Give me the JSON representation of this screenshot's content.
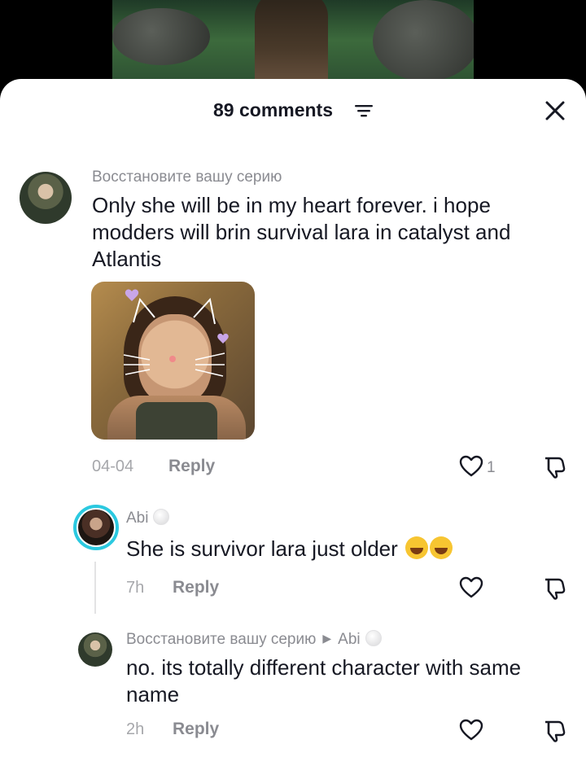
{
  "header": {
    "comment_count": "89 comments"
  },
  "comments": [
    {
      "username": "Восстановите вашу серию",
      "text": "Only she will be in my heart forever. i hope modders will brin survival lara in catalyst and Atlantis",
      "date": "04-04",
      "reply_label": "Reply",
      "likes": "1"
    }
  ],
  "replies": [
    {
      "username": "Abi",
      "text": "She is survivor lara just older",
      "time": "7h",
      "reply_label": "Reply"
    },
    {
      "username": "Восстановите вашу серию",
      "reply_to": "Abi",
      "text": "no. its totally different character with same name",
      "time": "2h",
      "reply_label": "Reply"
    }
  ],
  "colors": {
    "text_primary": "#161823",
    "text_secondary": "#8a8b91",
    "story_ring": "#2bc9e0"
  },
  "icons": [
    "filter-icon",
    "close-icon",
    "heart-icon",
    "dislike-icon",
    "laughing-emoji"
  ]
}
